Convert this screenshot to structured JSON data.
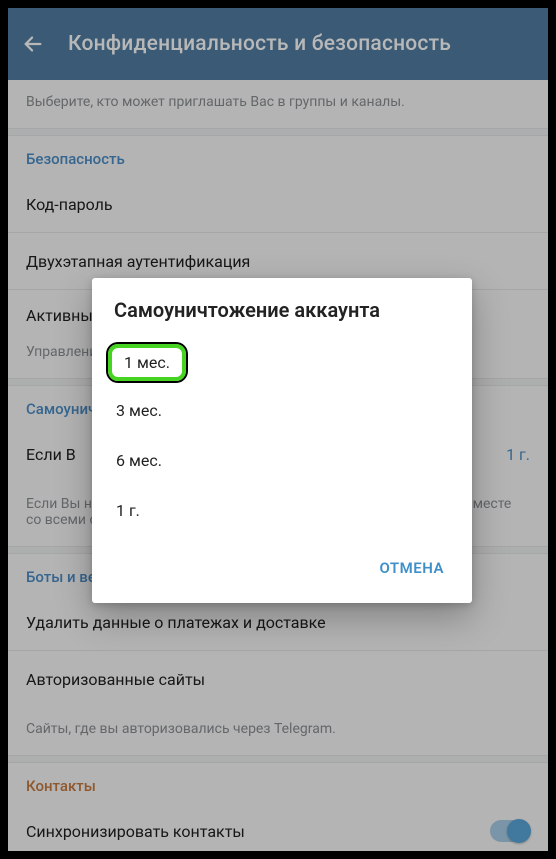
{
  "appbar": {
    "title": "Конфиденциальность и безопасность"
  },
  "groups_desc": "Выберите, кто может приглашать Вас в группы и каналы.",
  "security": {
    "header": "Безопасность",
    "passcode": "Код-пароль",
    "two_step": "Двухэтапная аутентификация",
    "active_sessions": "Активные сеансы",
    "manage_desc": "Управление сеансами"
  },
  "self_destruct": {
    "header": "Самоуничтожение аккаунта",
    "row_label": "Если В",
    "row_value": "1 г.",
    "desc": "Если Вы не будете заходить в Telegram, Ваш аккаунт будет удалён вместе со всеми сообщениями и контактами."
  },
  "bots": {
    "header": "Боты и веб-сайты",
    "clear_payments": "Удалить данные о платежах и доставке",
    "authorized_sites": "Авторизованные сайты",
    "sites_desc": "Сайты, где вы авторизовались через Telegram."
  },
  "contacts": {
    "header": "Контакты",
    "sync": "Синхронизировать контакты"
  },
  "dialog": {
    "title": "Самоуничтожение аккаунта",
    "options": [
      "1 мес.",
      "3 мес.",
      "6 мес.",
      "1 г."
    ],
    "selected_index": 0,
    "cancel": "ОТМЕНА"
  }
}
